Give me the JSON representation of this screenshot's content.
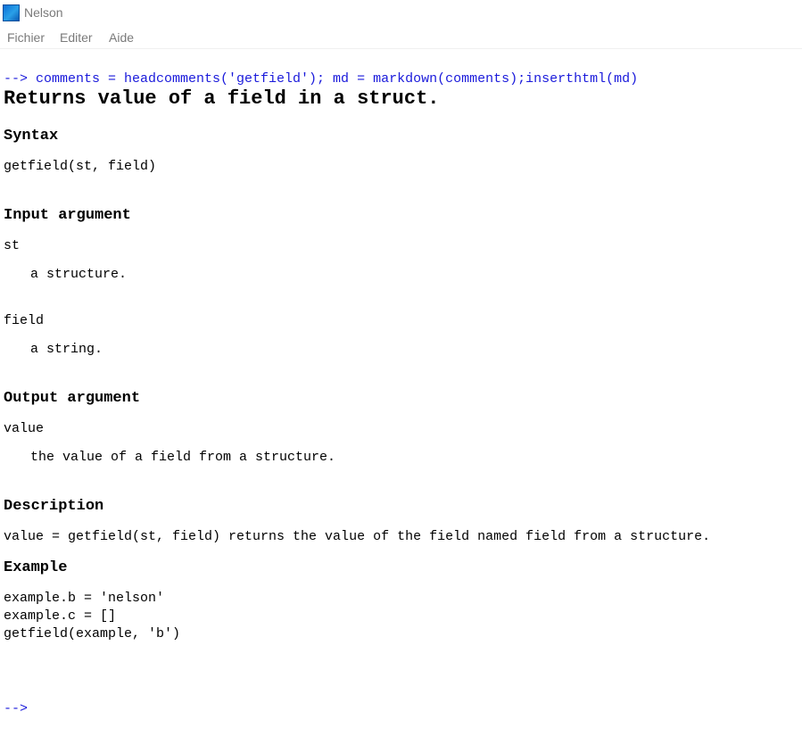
{
  "window": {
    "title": "Nelson",
    "icon": "nelson-app-icon"
  },
  "menu": {
    "items": [
      "Fichier",
      "Editer",
      "Aide"
    ]
  },
  "console": {
    "command": "--> comments = headcomments('getfield'); md = markdown(comments);inserthtml(md)",
    "doc": {
      "title": "Returns value of a field in a struct.",
      "syntax_heading": "Syntax",
      "syntax": "getfield(st, field)",
      "input_heading": "Input argument",
      "inputs": [
        {
          "name": "st",
          "desc": "a structure."
        },
        {
          "name": "field",
          "desc": "a string."
        }
      ],
      "output_heading": "Output argument",
      "outputs": [
        {
          "name": "value",
          "desc": "the value of a field from a structure."
        }
      ],
      "description_heading": "Description",
      "description": "value = getfield(st, field) returns the value of the field named field from a structure.",
      "example_heading": "Example",
      "example_lines": [
        "example.b = 'nelson'",
        "example.c = []",
        "getfield(example, 'b')"
      ]
    },
    "prompt": "-->"
  },
  "colors": {
    "command": "#1a1adb",
    "menu_text": "#7a7a7a",
    "background": "#ffffff"
  }
}
